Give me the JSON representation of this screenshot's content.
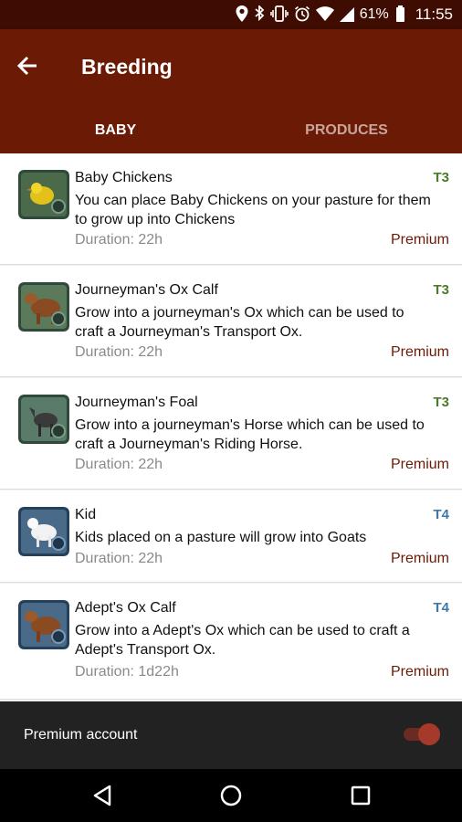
{
  "status": {
    "battery": "61%",
    "time": "11:55"
  },
  "app": {
    "title": "Breeding"
  },
  "tabs": [
    {
      "label": "BABY",
      "active": true
    },
    {
      "label": "PRODUCES",
      "active": false
    }
  ],
  "items": [
    {
      "name": "Baby Chickens",
      "tier": "T3",
      "tier_color": "#4a7a2a",
      "description": "You can place Baby Chickens on your pasture for them to grow up into Chickens",
      "duration": "Duration: 22h",
      "premium": "Premium",
      "icon": "baby-chicken-icon"
    },
    {
      "name": "Journeyman's Ox Calf",
      "tier": "T3",
      "tier_color": "#4a7a2a",
      "description": "Grow into a journeyman's Ox which can be used to craft a Journeyman's Transport Ox.",
      "duration": "Duration: 22h",
      "premium": "Premium",
      "icon": "ox-calf-icon"
    },
    {
      "name": "Journeyman's Foal",
      "tier": "T3",
      "tier_color": "#4a7a2a",
      "description": "Grow into a journeyman's Horse which can be used to craft a Journeyman's Riding Horse.",
      "duration": "Duration: 22h",
      "premium": "Premium",
      "icon": "foal-icon"
    },
    {
      "name": "Kid",
      "tier": "T4",
      "tier_color": "#3f78a6",
      "description": "Kids placed on a pasture will grow into Goats",
      "duration": "Duration: 22h",
      "premium": "Premium",
      "icon": "goat-kid-icon"
    },
    {
      "name": "Adept's Ox Calf",
      "tier": "T4",
      "tier_color": "#3f78a6",
      "description": "Grow into a Adept's Ox which can be used to craft a Adept's Transport Ox.",
      "duration": "Duration: 1d22h",
      "premium": "Premium",
      "icon": "ox-calf-icon"
    }
  ],
  "bottom": {
    "label": "Premium account",
    "toggle_on": true
  },
  "colors": {
    "status_bar": "#3e0c00",
    "app_bar": "#6b1a05",
    "accent": "#6b1a05",
    "bottom_bar": "#222222"
  }
}
